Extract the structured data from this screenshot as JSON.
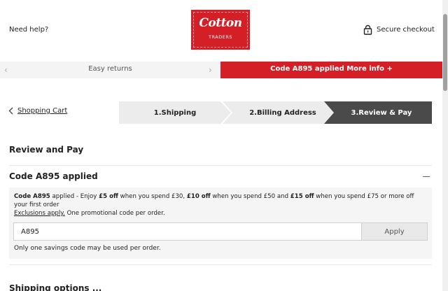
{
  "header": {
    "need_help": "Need help?",
    "logo_word": "Cotton",
    "logo_sub": "TRADERS",
    "secure_checkout": "Secure checkout"
  },
  "promo": {
    "left_text": "Easy returns",
    "right_text": "Code A895 applied More info +"
  },
  "nav": {
    "back_label": "Shopping Cart"
  },
  "steps": [
    {
      "label": "1.Shipping",
      "state": "done"
    },
    {
      "label": "2.Billing Address",
      "state": "done"
    },
    {
      "label": "3.Review & Pay",
      "state": "active"
    }
  ],
  "page": {
    "title": "Review and Pay"
  },
  "code_section": {
    "title": "Code A895 applied",
    "desc_code": "Code A895",
    "desc_1": " applied - Enjoy ",
    "desc_off1": "£5 off",
    "desc_2": " when you spend £30, ",
    "desc_off2": "£10 off",
    "desc_3": " when you spend £50 and ",
    "desc_off3": "£15 off",
    "desc_4": " when you spend £75 or more off your first order",
    "exclusions": "Exclusions apply.",
    "one_code": " One promotional code per order.",
    "input_value": "A895",
    "apply_label": "Apply",
    "note": "Only one savings code may be used per order."
  },
  "next_section": {
    "title": "Shipping options ..."
  },
  "colors": {
    "brand_red": "#d51f26",
    "active_step": "#4a4a4a"
  }
}
